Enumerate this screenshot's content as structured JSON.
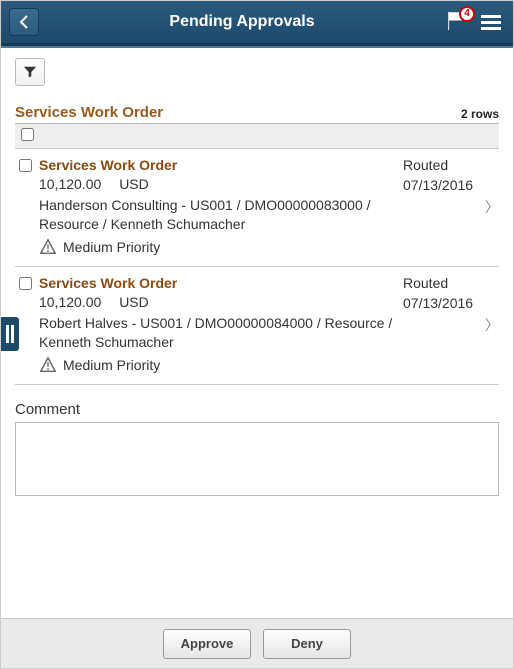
{
  "header": {
    "title": "Pending Approvals",
    "notification_count": "4"
  },
  "section": {
    "title": "Services Work Order",
    "row_count": "2 rows"
  },
  "items": [
    {
      "title": "Services Work Order",
      "amount": "10,120.00",
      "currency": "USD",
      "description": "Handerson Consulting - US001 / DMO00000083000 / Resource / Kenneth Schumacher",
      "priority": "Medium Priority",
      "status": "Routed",
      "date": "07/13/2016"
    },
    {
      "title": "Services Work Order",
      "amount": "10,120.00",
      "currency": "USD",
      "description": "Robert Halves - US001 / DMO00000084000 / Resource / Kenneth Schumacher",
      "priority": "Medium Priority",
      "status": "Routed",
      "date": "07/13/2016"
    }
  ],
  "comment": {
    "label": "Comment",
    "value": ""
  },
  "footer": {
    "approve_label": "Approve",
    "deny_label": "Deny"
  }
}
